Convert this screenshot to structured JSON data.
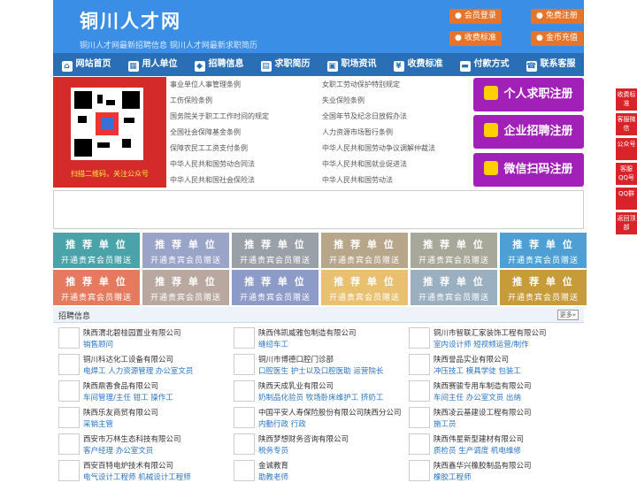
{
  "header": {
    "logo": "铜川人才网",
    "subtitle": "铜川人才网最新招聘信息   铜川人才网最新求职简历",
    "buttons": [
      {
        "label": "会员登录"
      },
      {
        "label": "免费注册"
      },
      {
        "label": "收费标准"
      },
      {
        "label": "金币充值"
      }
    ]
  },
  "nav": [
    {
      "label": "网站首页",
      "icon": "home-icon"
    },
    {
      "label": "用人单位",
      "icon": "building-icon"
    },
    {
      "label": "招聘信息",
      "icon": "megaphone-icon"
    },
    {
      "label": "求职简历",
      "icon": "resume-icon"
    },
    {
      "label": "职场资讯",
      "icon": "news-icon"
    },
    {
      "label": "收费标准",
      "icon": "money-icon"
    },
    {
      "label": "付款方式",
      "icon": "card-icon"
    },
    {
      "label": "联系客服",
      "icon": "phone-icon"
    }
  ],
  "qr_caption": "扫描二维码，关注公众号",
  "links": [
    "事业单位人事管理条例",
    "女职工劳动保护特别规定",
    "工伤保险条例",
    "失业保险条例",
    "国务院关于职工工作时间的规定",
    "全国年节及纪念日放假办法",
    "全国社会保障基金条例",
    "人力资源市场暂行条例",
    "保障农民工工资支付条例",
    "中华人民共和国劳动争议调解仲裁法",
    "中华人民共和国劳动合同法",
    "中华人民共和国就业促进法",
    "中华人民共和国社会保险法",
    "中华人民共和国劳动法"
  ],
  "register": [
    {
      "label": "个人求职注册"
    },
    {
      "label": "企业招聘注册"
    },
    {
      "label": "微信扫码注册"
    }
  ],
  "recommend": {
    "title": "推 荐 单 位",
    "sub": "开通贵宾会员赠送"
  },
  "rec_colors": {
    "row1": [
      "#4aa3a8",
      "#9aa3c8",
      "#9aa0a8",
      "#b8a68a",
      "#a8a89a",
      "#4d9fd4"
    ],
    "row2": [
      "#e57a5f",
      "#b8a8a0",
      "#8c9bc8",
      "#e8c070",
      "#9ab0c0",
      "#c79a3a"
    ]
  },
  "jobs_head": {
    "title": "招聘信息",
    "more": "更多»"
  },
  "jobs": [
    {
      "company": "陕西渭北碧桂园置业有限公司",
      "positions": "销售顾问"
    },
    {
      "company": "陕西伟凯威雅包制造有限公司",
      "positions": "缝纫车工"
    },
    {
      "company": "铜川市智联汇家装饰工程有限公司",
      "positions": "室内设计师 短视频运营/制作"
    },
    {
      "company": "铜川科达化工设备有限公司",
      "positions": "电焊工 人力资源管理 办公室文员"
    },
    {
      "company": "铜川市博德口腔门诊部",
      "positions": "口腔医生 护士以及口腔医助 运营院长"
    },
    {
      "company": "陕西誉品实业有限公司",
      "positions": "冲压技工 模具学徒 包装工"
    },
    {
      "company": "陕西鼎香食品有限公司",
      "positions": "车间管理/主任 钳工 操作工"
    },
    {
      "company": "陕西天成乳业有限公司",
      "positions": "奶制品化验员 牧场卧床维护工 挤奶工"
    },
    {
      "company": "陕西赛骏专用车制造有限公司",
      "positions": "车间主任 办公室文员 出纳"
    },
    {
      "company": "陕西乐友商贸有限公司",
      "positions": "采销主管"
    },
    {
      "company": "中国平安人寿保险股份有限公司陕西分公司",
      "positions": "内勤行政 行政"
    },
    {
      "company": "陕西凌云基建设工程有限公司",
      "positions": "施工员"
    },
    {
      "company": "西安市万林生态科技有限公司",
      "positions": "客户经理 办公室文员"
    },
    {
      "company": "陕西梦想财务咨询有限公司",
      "positions": "税务专员"
    },
    {
      "company": "陕西伟星新型建材有限公司",
      "positions": "质检员 生产调度 机电维修"
    },
    {
      "company": "西安百特电炉技术有限公司",
      "positions": "电气设计工程师 机械设计工程师"
    },
    {
      "company": "金诚教育",
      "positions": "助教老师"
    },
    {
      "company": "陕西鑫华兴橡胶制品有限公司",
      "positions": "橡胶工程师"
    }
  ],
  "side": [
    "收费标准",
    "客服微信",
    "公众号",
    "客服QQ号",
    "QQ群",
    "返回顶部"
  ]
}
